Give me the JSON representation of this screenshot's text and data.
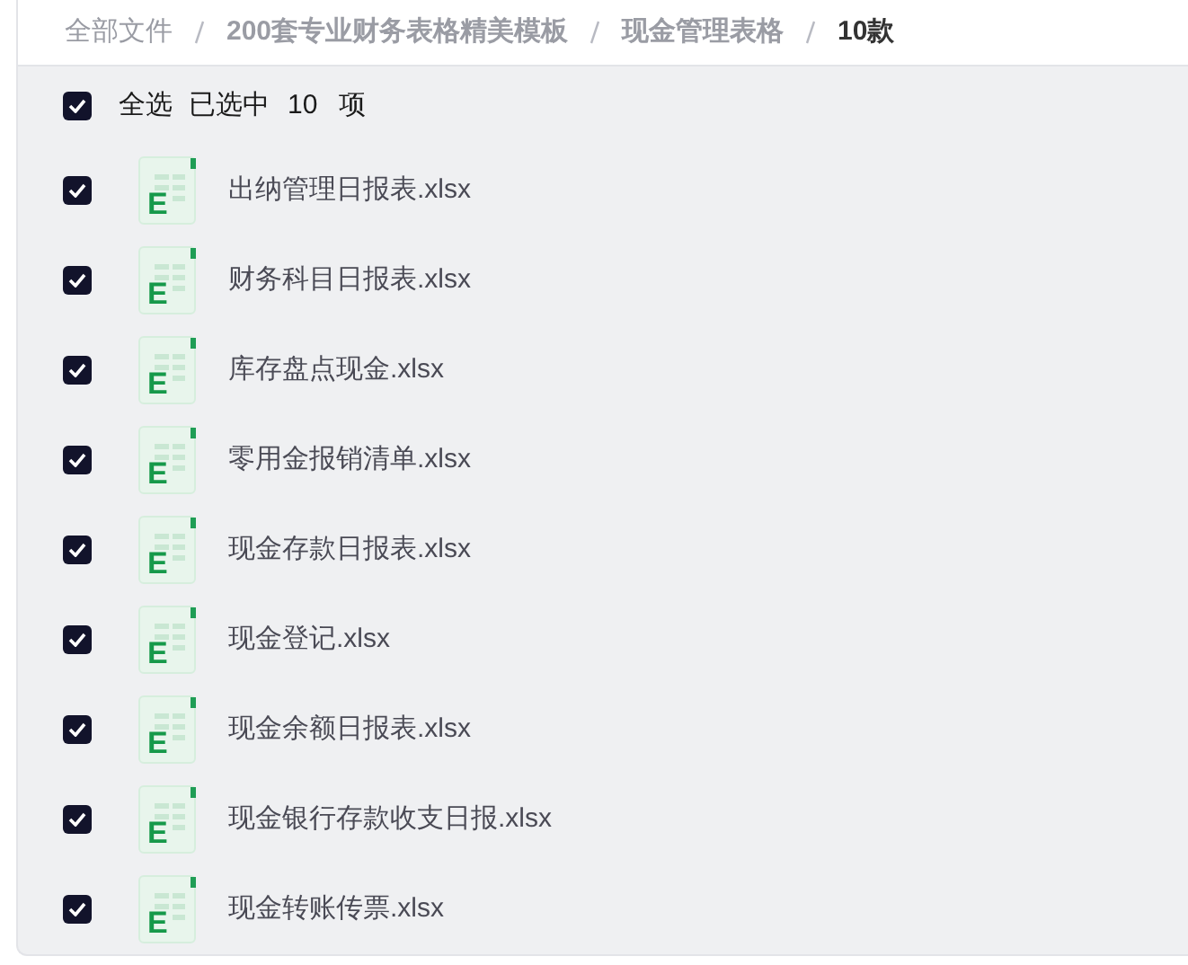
{
  "breadcrumb": [
    {
      "label": "全部文件",
      "current": false
    },
    {
      "label": "200套专业财务表格精美模板",
      "current": false
    },
    {
      "label": "现金管理表格",
      "current": false
    },
    {
      "label": "10款",
      "current": true
    }
  ],
  "select_all": {
    "checked": true,
    "label": "全选",
    "selected_prefix": "已选中",
    "selected_count": "10",
    "selected_suffix": "项"
  },
  "files": [
    {
      "name": "出纳管理日报表.xlsx",
      "checked": true,
      "icon_letter": "E"
    },
    {
      "name": "财务科目日报表.xlsx",
      "checked": true,
      "icon_letter": "E"
    },
    {
      "name": "库存盘点现金.xlsx",
      "checked": true,
      "icon_letter": "E"
    },
    {
      "name": "零用金报销清单.xlsx",
      "checked": true,
      "icon_letter": "E"
    },
    {
      "name": "现金存款日报表.xlsx",
      "checked": true,
      "icon_letter": "E"
    },
    {
      "name": "现金登记.xlsx",
      "checked": true,
      "icon_letter": "E"
    },
    {
      "name": "现金余额日报表.xlsx",
      "checked": true,
      "icon_letter": "E"
    },
    {
      "name": "现金银行存款收支日报.xlsx",
      "checked": true,
      "icon_letter": "E"
    },
    {
      "name": "现金转账传票.xlsx",
      "checked": true,
      "icon_letter": "E"
    }
  ]
}
